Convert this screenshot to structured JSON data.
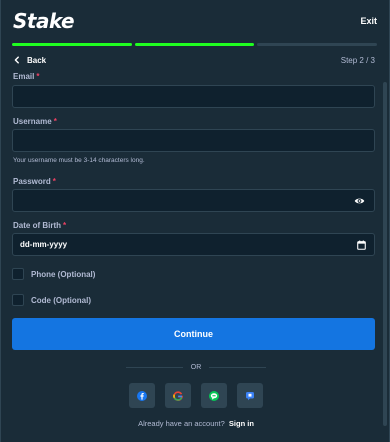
{
  "header": {
    "logo": "Stake",
    "exit_label": "Exit"
  },
  "progress": {
    "steps_total": 3,
    "steps_done": 2
  },
  "nav": {
    "back_label": "Back",
    "step_text": "Step 2 / 3"
  },
  "form": {
    "email_label": "Email",
    "username_label": "Username",
    "username_hint": "Your username must be 3-14 characters long.",
    "password_label": "Password",
    "dob_label": "Date of Birth",
    "dob_value": "dd-mm-yyyy",
    "required_mark": "*",
    "phone_label": "Phone (Optional)",
    "code_label": "Code (Optional)"
  },
  "actions": {
    "continue_label": "Continue",
    "or_text": "OR"
  },
  "socials": [
    {
      "name": "facebook-icon",
      "color": "#1877f2"
    },
    {
      "name": "google-icon",
      "color": "#ea4335"
    },
    {
      "name": "line-icon",
      "color": "#06c755"
    },
    {
      "name": "twitch-icon",
      "color": "#3b82f6"
    }
  ],
  "footer": {
    "account_text": "Already have an account?",
    "signin_label": "Sign in"
  },
  "colors": {
    "accent": "#1fff20",
    "primary": "#1475e1",
    "background": "#1a2c38"
  }
}
